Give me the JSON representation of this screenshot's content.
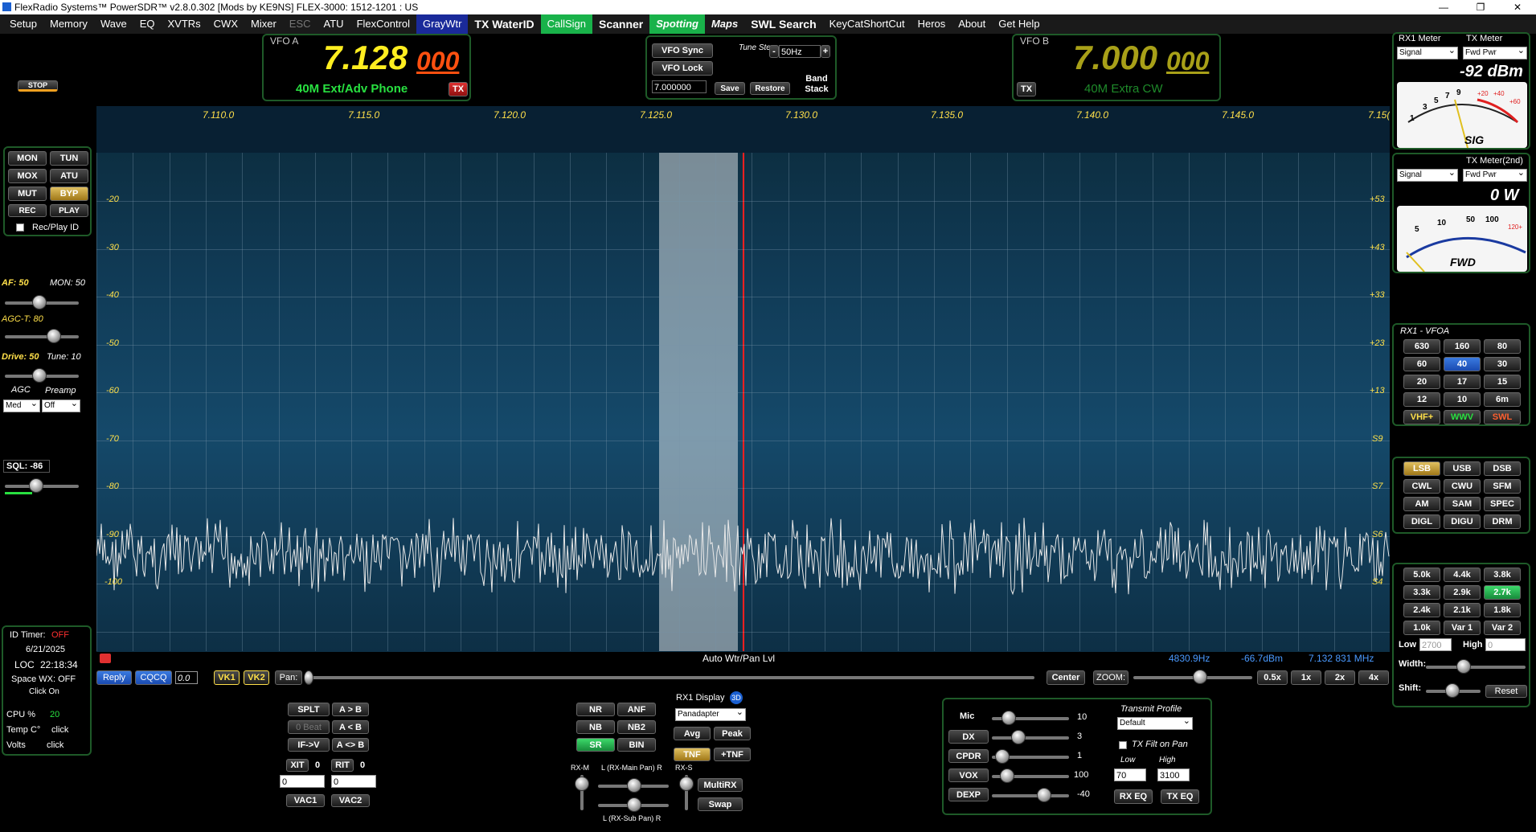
{
  "title": {
    "text": "FlexRadio Systems™  PowerSDR™  v2.8.0.302   [Mods by KE9NS]   FLEX-3000: 1512-1201 : US",
    "min": "—",
    "max": "❐",
    "close": "✕"
  },
  "menu": [
    "Setup",
    "Memory",
    "Wave",
    "EQ",
    "XVTRs",
    "CWX",
    "Mixer",
    "ESC",
    "ATU",
    "FlexControl",
    "GrayWtr",
    "TX WaterID",
    "CallSign",
    "Scanner",
    "Spotting",
    "Maps",
    "SWL Search",
    "KeyCatShortCut",
    "Heros",
    "About",
    "Get Help"
  ],
  "stop_label": "STOP",
  "vfoa": {
    "label": "VFO A",
    "mhz": "7.128",
    "hz": "000",
    "mode_text": "40M Ext/Adv Phone",
    "tx": "TX"
  },
  "vfob": {
    "label": "VFO B",
    "mhz": "7.000",
    "hz": "000",
    "mode_text": "40M Extra CW",
    "tx": "TX"
  },
  "vfo_ctrl": {
    "sync": "VFO Sync",
    "lock": "VFO Lock",
    "tune_step_label": "Tune Step:",
    "tune_step": "50Hz",
    "minus": "-",
    "plus": "+",
    "freq": "7.000000",
    "save": "Save",
    "restore": "Restore",
    "band_stack": "Band Stack"
  },
  "left_buttons": {
    "mon": "MON",
    "tun": "TUN",
    "mox": "MOX",
    "atu": "ATU",
    "mut": "MUT",
    "byp": "BYP",
    "rec": "REC",
    "play": "PLAY",
    "recplay": "Rec/Play ID"
  },
  "left_ctrl": {
    "af": "AF: 50",
    "mon": "MON: 50",
    "agct": "AGC-T:  80",
    "drive": "Drive: 50",
    "tune": "Tune: 10",
    "agc": "AGC",
    "preamp": "Preamp",
    "agc_val": "Med",
    "preamp_val": "Off",
    "sql": "SQL:  -86"
  },
  "status": {
    "id_timer": "ID Timer:",
    "id_timer_val": "OFF",
    "date": "6/21/2025",
    "loc": "LOC",
    "time": "22:18:34",
    "wx": "Space WX: OFF",
    "click_on": "Click On",
    "cpu": "CPU %",
    "cpu_val": "20",
    "temp": "Temp C°",
    "temp_val": "click",
    "volts": "Volts",
    "volts_val": "click"
  },
  "spectrum": {
    "freq_labels": [
      "7.110.0",
      "7.115.0",
      "7.120.0",
      "7.125.0",
      "7.130.0",
      "7.135.0",
      "7.140.0",
      "7.145.0",
      "7.15("
    ],
    "db_labels": [
      "-20",
      "-30",
      "-40",
      "-50",
      "-60",
      "-70",
      "-80",
      "-90",
      "-100"
    ],
    "s_labels": [
      "+53",
      "+43",
      "+33",
      "+23",
      "+13",
      "S9",
      "S7",
      "S6",
      "S4"
    ],
    "bottom_center": "Auto Wtr/Pan Lvl",
    "bottom_hz": "4830.9Hz",
    "bottom_dbm": "-66.7dBm",
    "bottom_freq": "7.132 831 MHz"
  },
  "pan_bar": {
    "reply": "Reply",
    "cqcq": "CQCQ",
    "val": "0.0",
    "vk1": "VK1",
    "vk2": "VK2",
    "pan": "Pan:",
    "center": "Center",
    "zoom": "ZOOM:",
    "z05": "0.5x",
    "z1": "1x",
    "z2": "2x",
    "z4": "4x"
  },
  "split": {
    "splt": "SPLT",
    "atob": "A > B",
    "beat": "0 Beat",
    "alessb": "A < B",
    "ifv": "IF->V",
    "aswap": "A <> B",
    "xit": "XIT",
    "xit_v": "0",
    "rit": "RIT",
    "rit_v": "0",
    "xit_num": "0",
    "rit_num": "0",
    "vac1": "VAC1",
    "vac2": "VAC2"
  },
  "dsp": {
    "nr": "NR",
    "anf": "ANF",
    "nb": "NB",
    "nb2": "NB2",
    "sr": "SR",
    "bin": "BIN",
    "rx1_display": "RX1 Display",
    "display_val": "Panadapter",
    "avg": "Avg",
    "peak": "Peak",
    "tnf": "TNF",
    "ptnf": "+TNF",
    "rxm": "RX-M",
    "rxs": "RX-S",
    "mainpan": "L (RX-Main Pan) R",
    "subpan": "L (RX-Sub Pan) R",
    "multirx": "MultiRX",
    "swap": "Swap",
    "3d": "3D"
  },
  "tx": {
    "mic": "Mic",
    "mic_v": "10",
    "dx": "DX",
    "dx_v": "3",
    "cpdr": "CPDR",
    "cpdr_v": "1",
    "vox": "VOX",
    "vox_v": "100",
    "dexp": "DEXP",
    "dexp_v": "-40",
    "profile": "Transmit Profile",
    "profile_val": "Default",
    "tx_filt": "TX Filt on Pan",
    "low": "Low",
    "high": "High",
    "low_v": "70",
    "high_v": "3100",
    "rxeq": "RX EQ",
    "txeq": "TX EQ"
  },
  "meter1": {
    "rx_label": "RX1 Meter",
    "tx_label": "TX Meter",
    "rx_sel": "Signal",
    "tx_sel": "Fwd Pwr",
    "reading": "-92 dBm",
    "scale": "SIG",
    "ticks": [
      "1",
      "3",
      "5",
      "7",
      "9",
      "+20",
      "+40",
      "+60"
    ]
  },
  "meter2": {
    "tx_label": "TX Meter(2nd)",
    "rx_sel": "Signal",
    "tx_sel": "Fwd Pwr",
    "reading": "0 W",
    "scale": "FWD",
    "ticks": [
      "5",
      "10",
      "50",
      "100",
      "120+"
    ]
  },
  "bands": {
    "title": "RX1 - VFOA",
    "items": [
      "630",
      "160",
      "80",
      "60",
      "40",
      "30",
      "20",
      "17",
      "15",
      "12",
      "10",
      "6m",
      "VHF+",
      "WWV",
      "SWL"
    ],
    "selected": "40"
  },
  "modes": {
    "items": [
      "LSB",
      "USB",
      "DSB",
      "CWL",
      "CWU",
      "SFM",
      "AM",
      "SAM",
      "SPEC",
      "DIGL",
      "DIGU",
      "DRM"
    ],
    "selected": "LSB"
  },
  "filters": {
    "items": [
      "5.0k",
      "4.4k",
      "3.8k",
      "3.3k",
      "2.9k",
      "2.7k",
      "2.4k",
      "2.1k",
      "1.8k",
      "1.0k",
      "Var 1",
      "Var 2"
    ],
    "selected": "2.7k",
    "low": "Low",
    "low_v": "2700",
    "high": "High",
    "high_v": "0",
    "width": "Width:",
    "shift": "Shift:",
    "reset": "Reset"
  }
}
